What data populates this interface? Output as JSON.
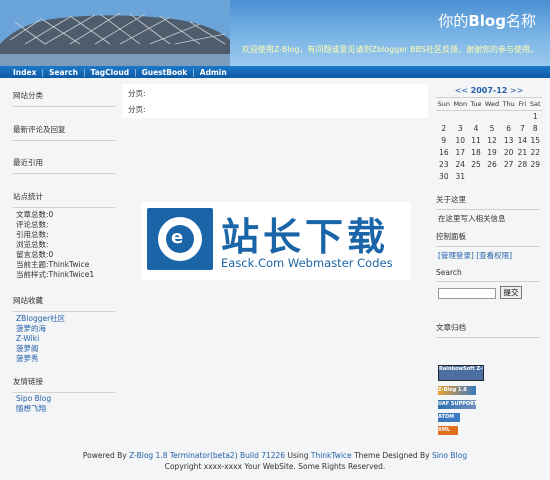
{
  "header": {
    "blog_name_prefix": "你的",
    "blog_name_bold": "Blog",
    "blog_name_suffix": "名称",
    "welcome": "欢迎使用Z-Blog，有问题或意见请到Zblogger BBS社区反馈，谢谢您的参与使用。"
  },
  "nav": [
    "Index",
    "Search",
    "TagCloud",
    "GuestBook",
    "Admin"
  ],
  "left": {
    "categories_title": "网站分类",
    "comments_title": "最新评论及回复",
    "trackbacks_title": "最近引用",
    "stats_title": "站点统计",
    "stats": [
      "文章总数:0",
      "评论总数:",
      "引用总数:",
      "浏览总数:",
      "留言总数:0",
      "当前主题:ThinkTwice",
      "当前样式:ThinkTwice1"
    ],
    "favorites_title": "网站收藏",
    "favorites": [
      "ZBlogger社区",
      "菠萝的海",
      "Z-Wiki",
      "菠萝阁",
      "菠萝秀"
    ],
    "links_title": "友情链接",
    "links": [
      "Sipo Blog",
      "随想飞翔"
    ]
  },
  "main": {
    "page_label_1": "分页:",
    "page_label_2": "分页:"
  },
  "watermark": {
    "cn": "站长下载",
    "en": "Easck.Com Webmaster Codes",
    "logo_letter": "e"
  },
  "calendar": {
    "prev": "<<",
    "month": "2007-12",
    "next": ">>",
    "weekdays": [
      "Sun",
      "Mon",
      "Tue",
      "Wed",
      "Thu",
      "Fri",
      "Sat"
    ],
    "weeks": [
      [
        "",
        "",
        "",
        "",
        "",
        "",
        "1"
      ],
      [
        "2",
        "3",
        "4",
        "5",
        "6",
        "7",
        "8"
      ],
      [
        "9",
        "10",
        "11",
        "12",
        "13",
        "14",
        "15"
      ],
      [
        "16",
        "17",
        "18",
        "19",
        "20",
        "21",
        "22"
      ],
      [
        "23",
        "24",
        "25",
        "26",
        "27",
        "28",
        "29"
      ],
      [
        "30",
        "31",
        "",
        "",
        "",
        "",
        ""
      ]
    ]
  },
  "right": {
    "about_title": "关于这里",
    "about_text": "在这里写入相关信息",
    "control_title": "控制面板",
    "control_links": "[管理登录] [查看权限]",
    "search_title": "Search",
    "search_button": "提交",
    "archives_title": "文章归档",
    "badges": [
      "RainbowSoft Z-Blog",
      "Z-Blog 1.8",
      "UAF SUPPORT",
      "ATOM",
      "XML"
    ]
  },
  "footer": {
    "powered_by": "Powered By",
    "zblog_link": "Z-Blog 1.8 Terminator(beta2) Build 71226",
    "using": "Using",
    "theme_link": "ThinkTwice",
    "designed_by": "Theme Designed By",
    "designer_link": "Sino Blog",
    "copyright": "Copyright xxxx-xxxx Your WebSite. Some Rights Reserved."
  },
  "colors": {
    "nav_bg": "#1e78c8",
    "link": "#2560a8",
    "header_sky": "#7bb5e6"
  }
}
